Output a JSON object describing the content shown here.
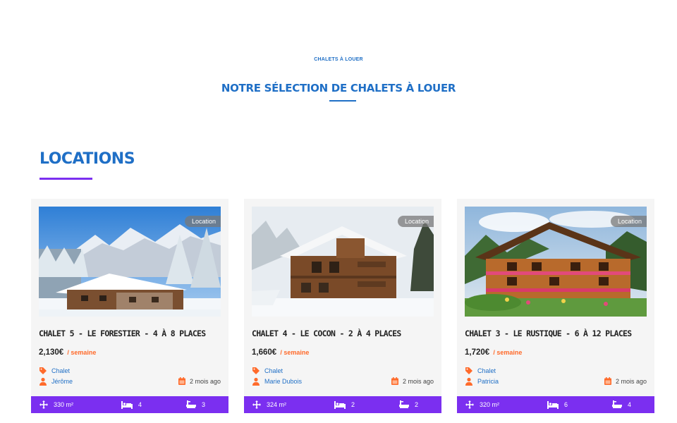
{
  "header": {
    "eyebrow": "CHALETS À LOUER",
    "title": "NOTRE SÉLECTION DE CHALETS À LOUER"
  },
  "section": {
    "title": "LOCATIONS"
  },
  "colors": {
    "primary": "#1f6fc6",
    "accent": "#7b2ff0",
    "orange": "#ff6a2a"
  },
  "cards": [
    {
      "badge": "Location",
      "title": "CHALET 5 - LE FORESTIER - 4 À 8 PLACES",
      "price": "2,130€",
      "period": "/ semaine",
      "category": "Chalet",
      "author": "Jérôme",
      "date": "2 mois ago",
      "area": "330 m²",
      "beds": "4",
      "baths": "3",
      "image": "snowy-chalet-photo"
    },
    {
      "badge": "Location",
      "title": "CHALET 4 - LE COCON - 2 À 4 PLACES",
      "price": "1,660€",
      "period": "/ semaine",
      "category": "Chalet",
      "author": "Marie Dubois",
      "date": "2 mois ago",
      "area": "324 m²",
      "beds": "2",
      "baths": "2",
      "image": "wooden-chalet-winter-photo"
    },
    {
      "badge": "Location",
      "title": "CHALET 3 - LE RUSTIQUE - 6 À 12 PLACES",
      "price": "1,720€",
      "period": "/ semaine",
      "category": "Chalet",
      "author": "Patricia",
      "date": "2 mois ago",
      "area": "320 m²",
      "beds": "6",
      "baths": "4",
      "image": "summer-chalet-flowers-photo"
    }
  ]
}
